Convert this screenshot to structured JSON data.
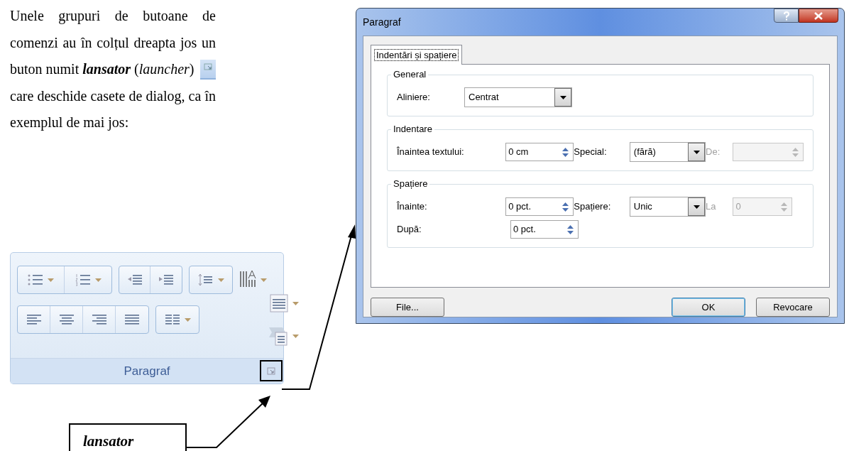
{
  "intro": {
    "lead": "Unele grupuri de butoane de comenzi au în colțul dreapta jos un",
    "before": "buton numit **lansator** (*launcher*)",
    "after": "care deschide casete de dialog, ca în exemplul de mai jos:"
  },
  "dialog": {
    "title": "Paragraf",
    "tabs": [
      {
        "label": "Indentări și spațiere",
        "selected": true
      }
    ],
    "groups": [
      {
        "title": "General",
        "rows": [
          [
            {
              "kind": "label",
              "text": "Aliniere:"
            },
            {
              "kind": "dropdown",
              "value": "Centrat"
            }
          ]
        ]
      },
      {
        "title": "Indentare",
        "rows": [
          [
            {
              "kind": "label",
              "text": "Înaintea textului:"
            },
            {
              "kind": "spinner",
              "value": "0 cm"
            },
            {
              "kind": "label",
              "text": "Special:"
            },
            {
              "kind": "dropdown",
              "value": "(fără)"
            },
            {
              "kind": "label",
              "text": "De:",
              "disabled": true
            },
            {
              "kind": "spinner",
              "disabled": true
            }
          ]
        ]
      },
      {
        "title": "Spațiere",
        "rows": [
          [
            {
              "kind": "label",
              "text": "Înainte:"
            },
            {
              "kind": "spinner",
              "value": "0 pct."
            },
            {
              "kind": "label",
              "text": "Spațiere:"
            },
            {
              "kind": "dropdown",
              "value": "Unic"
            },
            {
              "kind": "label",
              "text": "La",
              "disabled": true
            },
            {
              "kind": "spinner",
              "value": "0",
              "disabled": true
            }
          ],
          [
            {
              "kind": "label",
              "text": "După:"
            },
            {
              "kind": "spinner",
              "value": "0 pct."
            }
          ]
        ]
      }
    ],
    "buttons": [
      {
        "label": "File...",
        "default": false
      },
      {
        "label": "OK",
        "default": true
      },
      {
        "label": "Revocare",
        "default": false
      }
    ]
  },
  "ribbon": {
    "group_title": "Paragraf"
  },
  "callout": {
    "label": "lansator"
  }
}
